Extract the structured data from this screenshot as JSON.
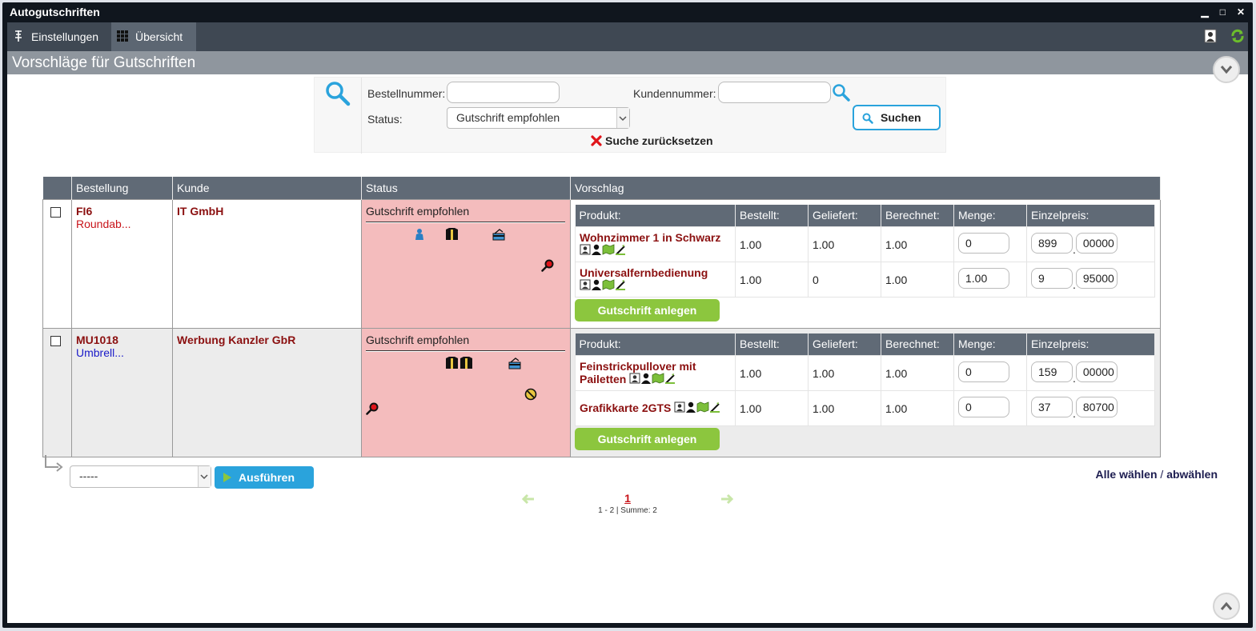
{
  "window": {
    "title": "Autogutschriften"
  },
  "toolbar": {
    "settings_label": "Einstellungen",
    "overview_label": "Übersicht"
  },
  "page": {
    "title": "Vorschläge für Gutschriften"
  },
  "search": {
    "order_label": "Bestellnummer:",
    "order_value": "",
    "customer_label": "Kundennummer:",
    "customer_value": "",
    "status_label": "Status:",
    "status_value": "Gutschrift empfohlen",
    "search_button": "Suchen",
    "reset_label": "Suche zurücksetzen"
  },
  "table": {
    "columns": [
      "Bestellung",
      "Kunde",
      "Status",
      "Vorschlag"
    ],
    "sub_columns": [
      "Produkt:",
      "Bestellt:",
      "Geliefert:",
      "Berechnet:",
      "Menge:",
      "Einzelpreis:"
    ],
    "create_button": "Gutschrift anlegen",
    "rows": [
      {
        "order": "FI6",
        "order_sub": "Roundab...",
        "customer": "IT GmbH",
        "status": "Gutschrift empfohlen",
        "products": [
          {
            "name": "Wohnzimmer 1 in Schwarz",
            "ordered": "1.00",
            "delivered": "1.00",
            "billed": "1.00",
            "qty": "0",
            "price_int": "899",
            "price_dec": "00000"
          },
          {
            "name": "Universalfernbedienung",
            "ordered": "1.00",
            "delivered": "0",
            "billed": "1.00",
            "qty": "1.00",
            "price_int": "9",
            "price_dec": "95000"
          }
        ]
      },
      {
        "order": "MU1018",
        "order_sub": "Umbrell...",
        "customer": "Werbung Kanzler GbR",
        "status": "Gutschrift empfohlen",
        "products": [
          {
            "name": "Feinstrickpullover mit Pailetten",
            "ordered": "1.00",
            "delivered": "1.00",
            "billed": "1.00",
            "qty": "0",
            "price_int": "159",
            "price_dec": "00000"
          },
          {
            "name": "Grafikkarte 2GTS",
            "ordered": "1.00",
            "delivered": "1.00",
            "billed": "1.00",
            "qty": "0",
            "price_int": "37",
            "price_dec": "80700"
          }
        ]
      }
    ]
  },
  "bulk": {
    "action_value": "-----",
    "execute_button": "Ausführen",
    "select_all": "Alle wählen",
    "separator": "/",
    "deselect_all": "abwählen"
  },
  "pager": {
    "current": "1",
    "info": "1 - 2 | Summe: 2"
  },
  "colors": {
    "accent_blue": "#2aa3dc",
    "accent_green": "#8cc63e",
    "status_red": "#f4bcbd",
    "header_gray": "#606a76",
    "dark_red": "#8b1010"
  }
}
